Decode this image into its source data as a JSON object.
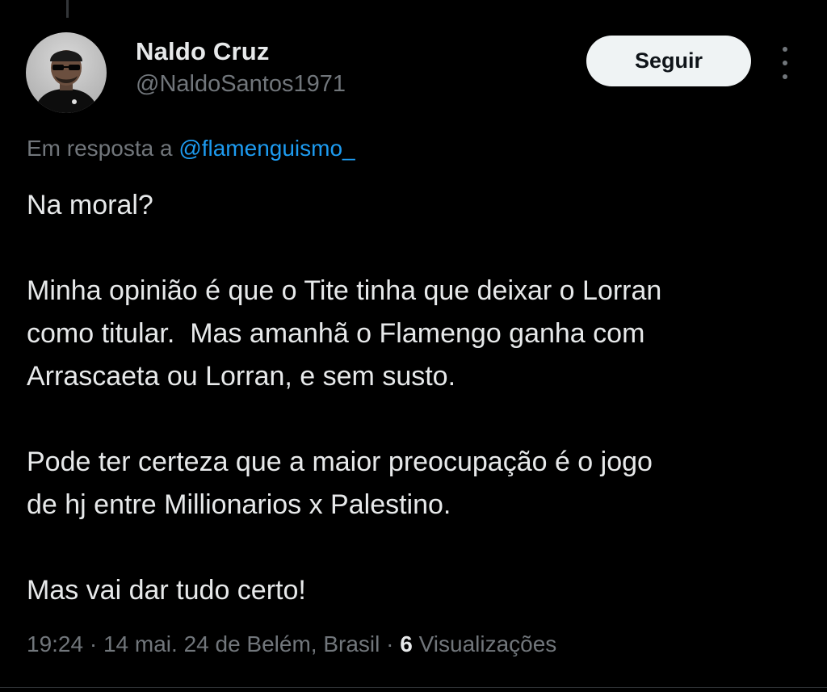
{
  "author": {
    "name": "Naldo Cruz",
    "handle": "@NaldoSantos1971"
  },
  "follow_button": {
    "label": "Seguir"
  },
  "reply": {
    "prefix": "Em resposta a ",
    "mention": "@flamenguismo_"
  },
  "tweet": {
    "paragraphs": [
      "Na moral?",
      "Minha opinião é que o Tite tinha que deixar o Lorran\ncomo titular.  Mas amanhã o Flamengo ganha com\nArrascaeta ou Lorran, e sem susto.",
      "Pode ter certeza que a maior preocupação é o jogo\nde hj entre Millionarios x Palestino.",
      "Mas vai dar tudo certo!"
    ]
  },
  "meta": {
    "time": "19:24",
    "date": "14 mai. 24 de Belém, Brasil",
    "separator": " · ",
    "views_count": "6",
    "views_label": "Visualizações"
  },
  "colors": {
    "background": "#000000",
    "text_primary": "#e7e9ea",
    "text_secondary": "#71767b",
    "link": "#1d9bf0",
    "button_bg": "#eff3f4"
  },
  "icons": {
    "more": "more-vertical-icon"
  }
}
